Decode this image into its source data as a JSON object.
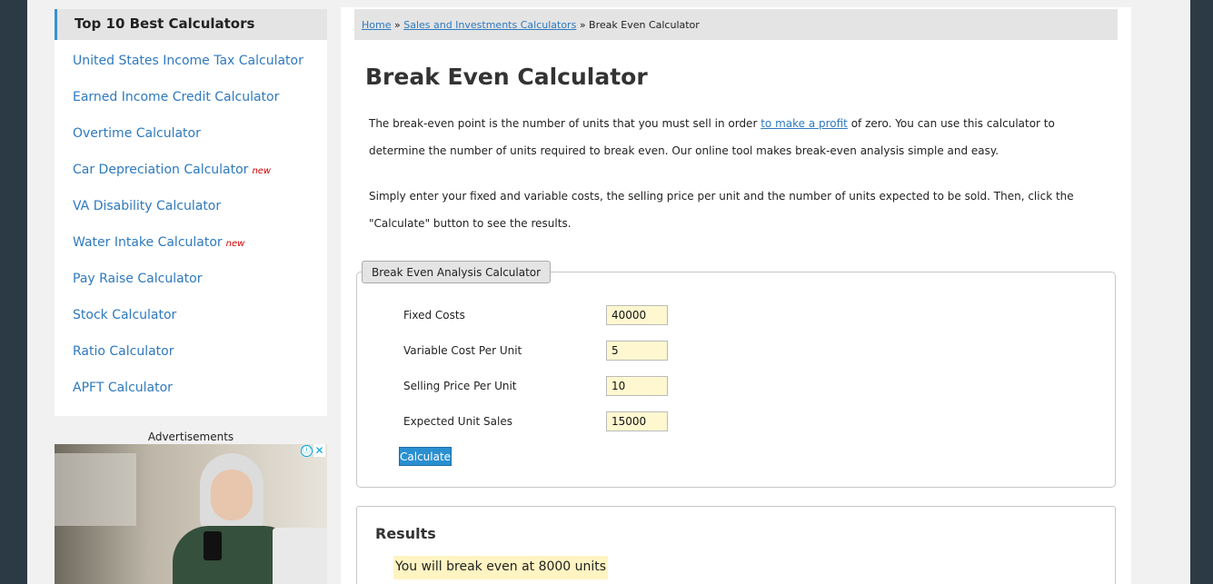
{
  "sidebar": {
    "heading": "Top 10 Best Calculators",
    "items": [
      {
        "label": "United States Income Tax Calculator",
        "badge": ""
      },
      {
        "label": "Earned Income Credit Calculator",
        "badge": ""
      },
      {
        "label": "Overtime Calculator",
        "badge": ""
      },
      {
        "label": "Car Depreciation Calculator",
        "badge": "new"
      },
      {
        "label": "VA Disability Calculator",
        "badge": ""
      },
      {
        "label": "Water Intake Calculator",
        "badge": "new"
      },
      {
        "label": "Pay Raise Calculator",
        "badge": ""
      },
      {
        "label": "Stock Calculator",
        "badge": ""
      },
      {
        "label": "Ratio Calculator",
        "badge": ""
      },
      {
        "label": "APFT Calculator",
        "badge": ""
      }
    ],
    "ads_label": "Advertisements",
    "ad_info_icon": "ⓘ",
    "ad_close_icon": "✕"
  },
  "breadcrumb": {
    "home": "Home",
    "separator": "»",
    "section": "Sales and Investments Calculators",
    "current": "Break Even Calculator"
  },
  "page": {
    "title": "Break Even Calculator",
    "intro_part1": "The break-even point is the number of units that you must sell in order ",
    "intro_link": "to make a profit",
    "intro_part2": " of zero. You can use this calculator to determine the number of units required to break even. Our online tool makes break-even analysis simple and easy.",
    "instructions": "Simply enter your fixed and variable costs, the selling price per unit and the number of units expected to be sold. Then, click the \"Calculate\" button to see the results."
  },
  "calculator": {
    "legend": "Break Even Analysis Calculator",
    "fields": [
      {
        "label": "Fixed Costs",
        "value": "40000"
      },
      {
        "label": "Variable Cost Per Unit",
        "value": "5"
      },
      {
        "label": "Selling Price Per Unit",
        "value": "10"
      },
      {
        "label": "Expected Unit Sales",
        "value": "15000"
      }
    ],
    "button_label": "Calculate"
  },
  "results": {
    "title": "Results",
    "text": "You will break even at 8000 units"
  },
  "colors": {
    "accent": "#2e79be",
    "button": "#2a8fd0",
    "input_bg": "#fff7d0",
    "new_badge": "#d40000"
  }
}
